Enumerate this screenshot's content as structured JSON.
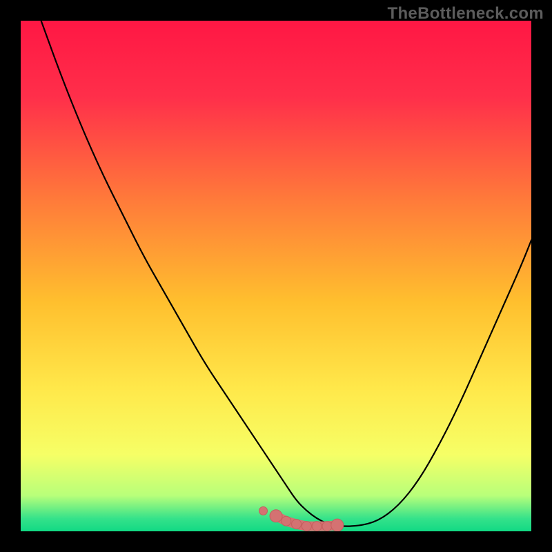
{
  "watermark": "TheBottleneck.com",
  "colors": {
    "gradient_stops": [
      {
        "offset": 0.0,
        "color": "#ff1744"
      },
      {
        "offset": 0.15,
        "color": "#ff2f4a"
      },
      {
        "offset": 0.35,
        "color": "#ff7a3a"
      },
      {
        "offset": 0.55,
        "color": "#ffbf2e"
      },
      {
        "offset": 0.72,
        "color": "#ffe84a"
      },
      {
        "offset": 0.85,
        "color": "#f6ff66"
      },
      {
        "offset": 0.93,
        "color": "#b8ff7a"
      },
      {
        "offset": 0.975,
        "color": "#35e28a"
      },
      {
        "offset": 1.0,
        "color": "#11d984"
      }
    ],
    "curve": "#000000",
    "marker_fill": "#d47272",
    "marker_stroke": "#c45e5e"
  },
  "chart_data": {
    "type": "line",
    "title": "",
    "xlabel": "",
    "ylabel": "",
    "xlim": [
      0,
      100
    ],
    "ylim": [
      0,
      100
    ],
    "x": [
      4,
      8,
      12,
      16,
      20,
      24,
      28,
      32,
      36,
      40,
      44,
      48,
      50,
      52,
      54,
      56,
      58,
      60,
      62,
      66,
      70,
      74,
      78,
      82,
      86,
      90,
      94,
      98,
      100
    ],
    "values": [
      100,
      89,
      79,
      70,
      62,
      54,
      47,
      40,
      33,
      27,
      21,
      15,
      12,
      9,
      6,
      4,
      2.5,
      1.5,
      1,
      1,
      2,
      5,
      10,
      17,
      25,
      34,
      43,
      52,
      57
    ],
    "flat_region": {
      "x_start": 50,
      "x_end": 62,
      "y": 1
    },
    "markers": [
      {
        "x": 50,
        "y": 3
      },
      {
        "x": 52,
        "y": 2
      },
      {
        "x": 54,
        "y": 1.4
      },
      {
        "x": 56,
        "y": 1
      },
      {
        "x": 58,
        "y": 1
      },
      {
        "x": 60,
        "y": 1
      },
      {
        "x": 62,
        "y": 1.2
      }
    ]
  }
}
